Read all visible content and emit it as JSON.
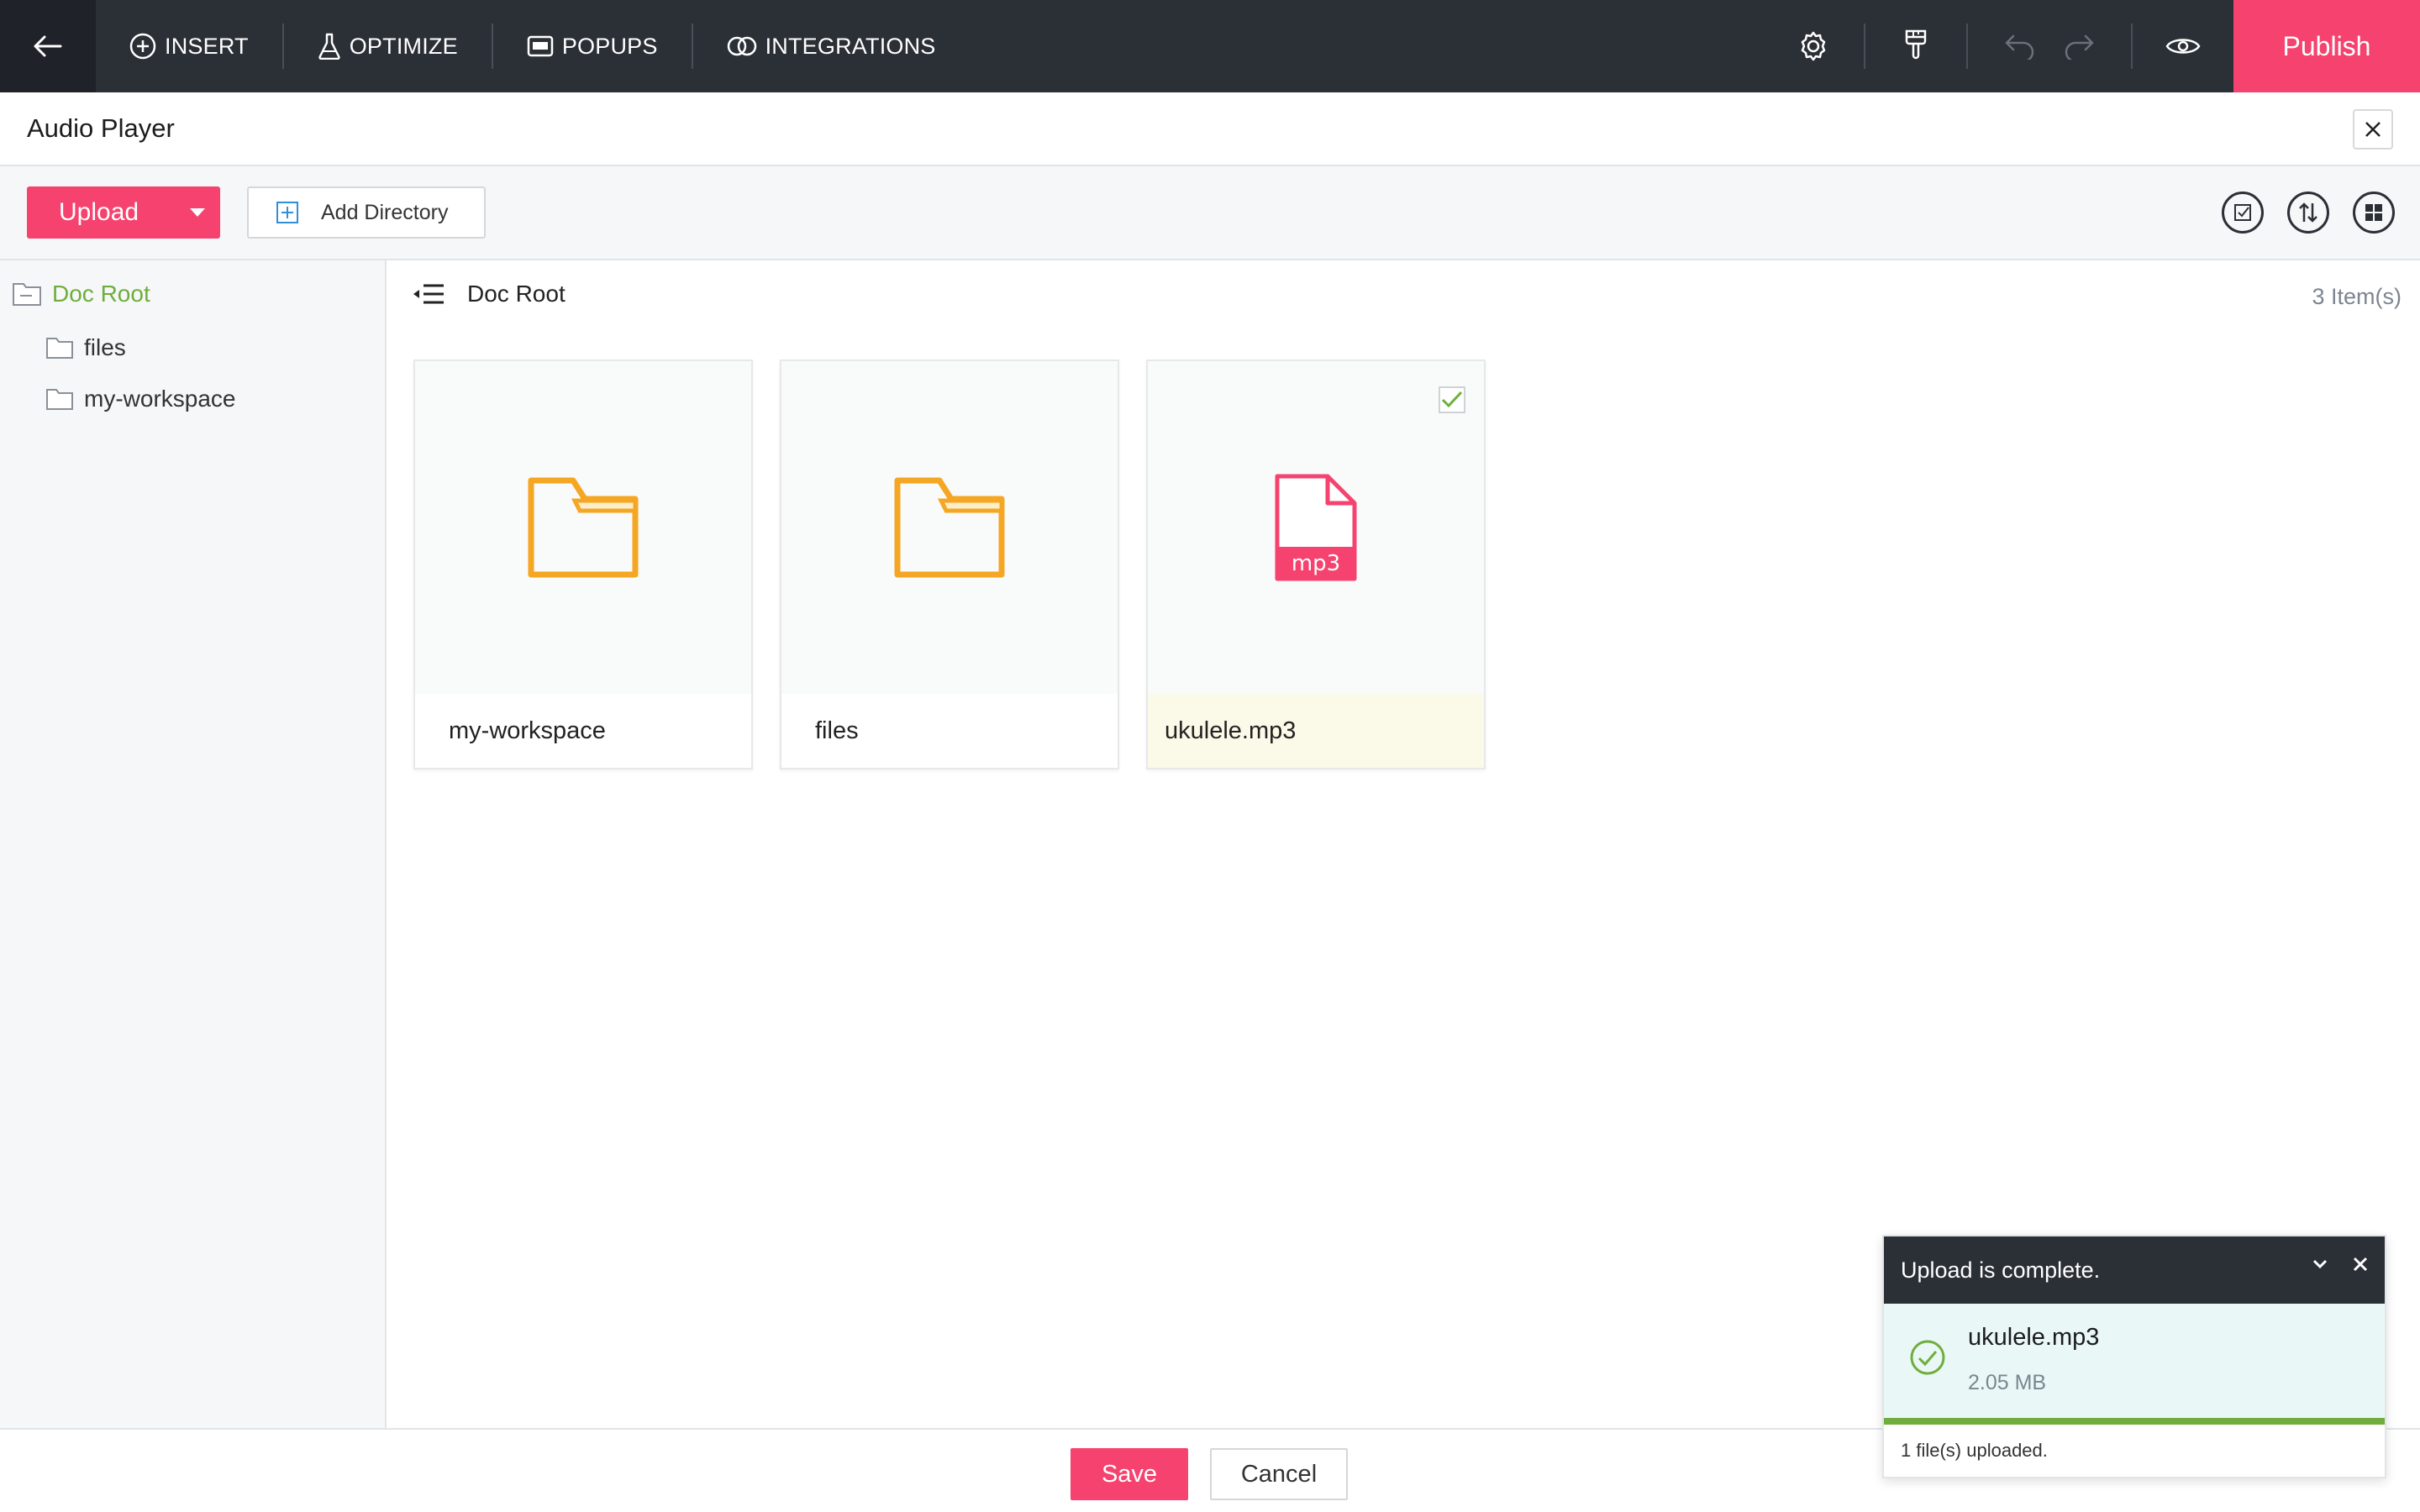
{
  "topbar": {
    "menu": [
      {
        "label": "INSERT",
        "icon": "plus-circle-icon"
      },
      {
        "label": "OPTIMIZE",
        "icon": "flask-icon"
      },
      {
        "label": "POPUPS",
        "icon": "popup-window-icon"
      },
      {
        "label": "INTEGRATIONS",
        "icon": "link-rings-icon"
      }
    ],
    "publish_label": "Publish"
  },
  "dialog": {
    "title": "Audio Player"
  },
  "toolbar": {
    "upload_label": "Upload",
    "add_directory_label": "Add Directory"
  },
  "sidebar": {
    "root": "Doc Root",
    "children": [
      "files",
      "my-workspace"
    ]
  },
  "content": {
    "breadcrumb": "Doc Root",
    "item_count": "3 Item(s)",
    "items": [
      {
        "name": "my-workspace",
        "type": "folder"
      },
      {
        "name": "files",
        "type": "folder"
      },
      {
        "name": "ukulele.mp3",
        "type": "file",
        "badge": "mp3",
        "selected": true
      }
    ]
  },
  "footer": {
    "save_label": "Save",
    "cancel_label": "Cancel"
  },
  "toast": {
    "title": "Upload is complete.",
    "file_name": "ukulele.mp3",
    "file_size": "2.05 MB",
    "progress": 1.0,
    "summary": "1 file(s) uploaded."
  },
  "colors": {
    "accent": "#f5426e",
    "topbar": "#2b2f36",
    "folder": "#f5a623",
    "tree_active": "#6fae3c",
    "success": "#6fae3c"
  }
}
